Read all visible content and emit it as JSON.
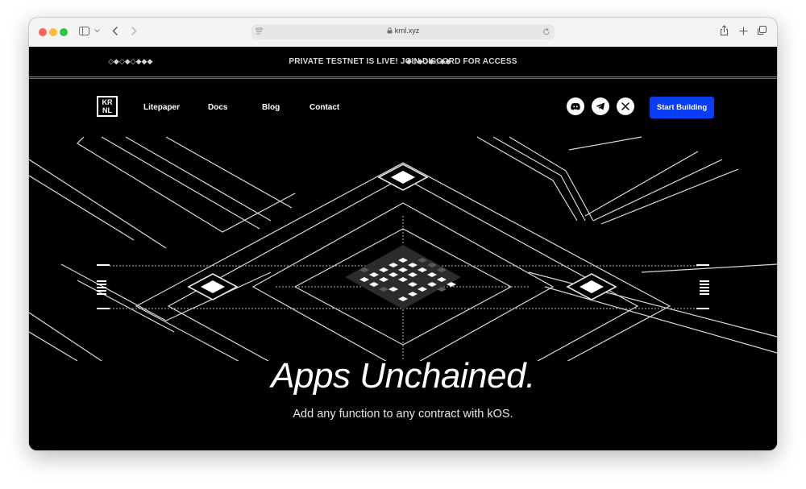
{
  "browser": {
    "url": "krnl.xyz"
  },
  "announcement": {
    "text": "PRIVATE TESTNET IS LIVE! JOIN DISCORD FOR ACCESS",
    "diamonds_left": "◇◆◇◆◇◆◆◆",
    "diamonds_right": "◆◇◆◇◆◇◆◆"
  },
  "nav": {
    "logo_line1": "KR",
    "logo_line2": "NL",
    "links": [
      "Litepaper",
      "Docs",
      "Blog",
      "Contact"
    ],
    "social_icons": [
      "discord-icon",
      "telegram-icon",
      "x-icon"
    ],
    "cta_label": "Start Building",
    "cta_color": "#0b3df5"
  },
  "hero": {
    "headline": "Apps Unchained.",
    "subline": "Add any function to any contract with kOS."
  }
}
